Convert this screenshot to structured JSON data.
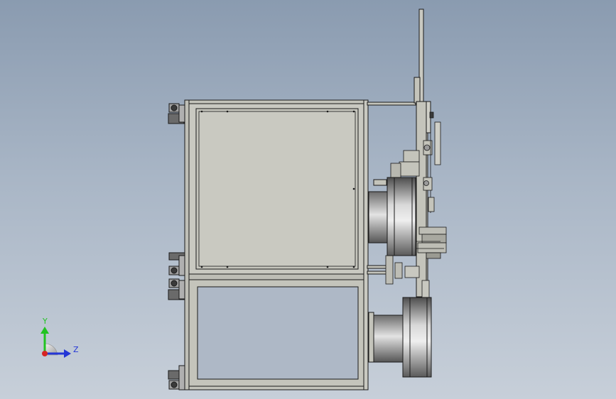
{
  "viewport": {
    "background_top": "#8a9bb0",
    "background_bottom": "#c7cfd9"
  },
  "triad": {
    "y_label": "Y",
    "z_label": "Z",
    "y_color": "#22c322",
    "z_color": "#2436d6",
    "x_color": "#d62424",
    "origin_fill": "#b8b8b8"
  },
  "model": {
    "panel_color": "#c9c9c1",
    "frame_color": "#b9b9b1",
    "line_color": "#1a1a1a",
    "drum_dark": "#5f5f5f",
    "drum_light": "#e8e8e8"
  }
}
